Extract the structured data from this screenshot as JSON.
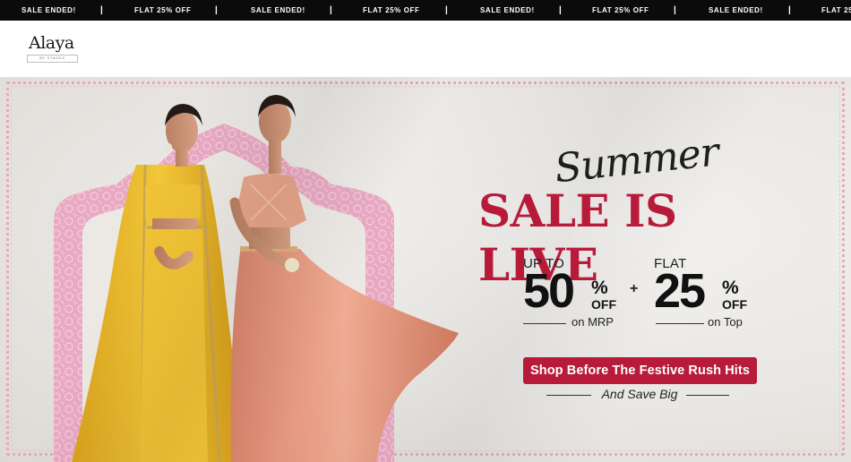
{
  "ticker": {
    "items": [
      "SALE ENDED!",
      "FLAT 25% OFF",
      "SALE ENDED!",
      "FLAT 25% OFF",
      "SALE ENDED!",
      "FLAT 25% OFF",
      "SALE ENDED!",
      "FLAT 25"
    ],
    "separator": "|"
  },
  "header": {
    "logo_text": "Alaya",
    "logo_subtext": "BY STAGE3"
  },
  "banner": {
    "script_title": "Summer",
    "headline": "SALE IS LIVE",
    "offers": [
      {
        "prefix": "UP TO",
        "value": "50",
        "percent": "%",
        "off": "OFF",
        "note": "on MRP"
      },
      {
        "prefix": "FLAT",
        "value": "25",
        "percent": "%",
        "off": "OFF",
        "note": "on Top"
      }
    ],
    "plus": "+",
    "cta_label": "Shop Before The Festive Rush Hits",
    "tagline": "And Save Big"
  },
  "colors": {
    "ticker_bg": "#0b0b0b",
    "accent": "#b81b3a",
    "arch_pink": "#e7a6c0",
    "outfit_yellow": "#e9b92a",
    "outfit_peach": "#e2967b"
  },
  "icons": {
    "logo": "alaya-logo"
  }
}
